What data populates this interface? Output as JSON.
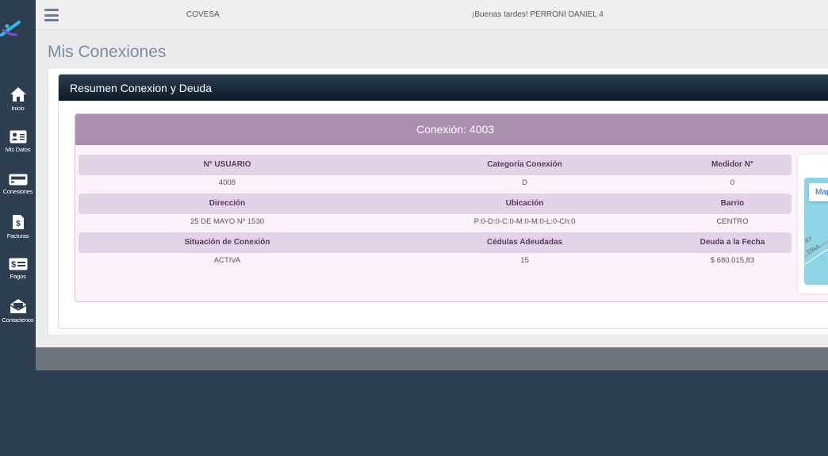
{
  "topbar": {
    "brand": "COVESA",
    "greeting": "¡Buenas tardes! PERRONI DANIEL 4"
  },
  "sidebar": {
    "items": [
      {
        "label": "Inicio",
        "icon": "home-icon"
      },
      {
        "label": "Mis Datos",
        "icon": "id-card-icon"
      },
      {
        "label": "Conexiones",
        "icon": "meter-icon"
      },
      {
        "label": "Facturas",
        "icon": "invoice-icon"
      },
      {
        "label": "Pagos",
        "icon": "payment-icon"
      },
      {
        "label": "Contactenos",
        "icon": "envelope-open-icon"
      }
    ]
  },
  "page": {
    "title": "Mis Conexiones"
  },
  "panel": {
    "title": "Resumen Conexion y Deuda"
  },
  "connection": {
    "title": "Conexión: 4003",
    "rows": [
      {
        "headers": [
          "N° USUARIO",
          "Categoría Conexión",
          "Medidor N°"
        ],
        "values": [
          "4008",
          "D",
          "0"
        ]
      },
      {
        "headers": [
          "Dirección",
          "Ubicación",
          "Barrio"
        ],
        "values": [
          "25 DE MAYO Nº 1530",
          "P:0-D:0-C:0-M:0-M:0-L:0-Ch:0",
          "CENTRO"
        ]
      },
      {
        "headers": [
          "Situación de Conexión",
          "Cédulas Adeudadas",
          "Deuda a la Fecha"
        ],
        "values": [
          "ACTIVA",
          "15",
          "$ 680.015,83"
        ]
      }
    ]
  },
  "map": {
    "button_label": "Map",
    "street_label_1": "AY",
    "street_label_2": "TINA"
  },
  "colors": {
    "sidebar_bg": "#2c3e50",
    "panel_header": "#0d1a27",
    "card_header": "#ab8fae",
    "card_bg": "#fcf2fc",
    "row_header_bg": "#e3d3e6",
    "map_water": "#8fd3e6"
  }
}
